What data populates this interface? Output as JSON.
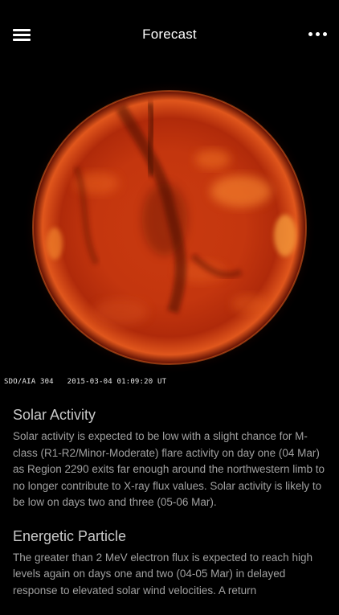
{
  "header": {
    "title": "Forecast"
  },
  "image": {
    "caption": "SDO/AIA 304   2015-03-04 01:09:20 UT",
    "colors": {
      "sun_core": "#e8501a",
      "sun_edge": "#8a1505",
      "background": "#000000"
    }
  },
  "sections": [
    {
      "title": "Solar Activity",
      "body": "Solar activity is expected to be low with a slight chance for M-class (R1-R2/Minor-Moderate) flare activity on day one (04 Mar) as Region 2290 exits far enough around the northwestern limb to no longer contribute to X-ray flux values. Solar activity is likely to be low on days two and three (05-06 Mar)."
    },
    {
      "title": "Energetic Particle",
      "body": "The greater than 2 MeV electron flux is expected to reach high levels again on days one and two (04-05 Mar) in delayed response to elevated solar wind velocities. A return"
    }
  ]
}
